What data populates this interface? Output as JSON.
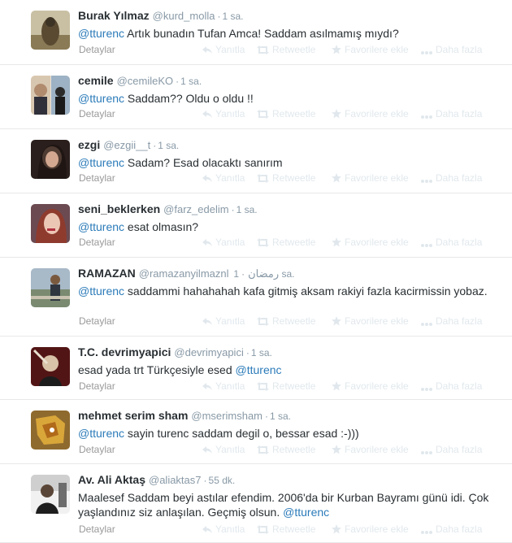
{
  "labels": {
    "details": "Detaylar",
    "reply": "Yanıtla",
    "retweet": "Retweetle",
    "favorite": "Favorilere ekle",
    "more": "Daha fazla"
  },
  "tweets": [
    {
      "name": "Burak Yılmaz",
      "handle": "@kurd_molla",
      "dot": "·",
      "time": "1 sa.",
      "segments": [
        {
          "t": "@tturenc",
          "m": true
        },
        {
          "t": " Artık bunadın Tufan Amca! Saddam asılmamış mıydı?",
          "m": false
        }
      ]
    },
    {
      "name": "cemile",
      "handle": "@cemileKO",
      "dot": "·",
      "time": "1 sa.",
      "segments": [
        {
          "t": "@tturenc",
          "m": true
        },
        {
          "t": " Saddam?? Oldu o oldu !!",
          "m": false
        }
      ]
    },
    {
      "name": "ezgi",
      "handle": "@ezgii__t",
      "dot": "·",
      "time": "1 sa.",
      "segments": [
        {
          "t": "@tturenc",
          "m": true
        },
        {
          "t": " Sadam? Esad olacaktı sanırım",
          "m": false
        }
      ]
    },
    {
      "name": "seni_beklerken",
      "handle": "@farz_edelim",
      "dot": "·",
      "time": "1 sa.",
      "segments": [
        {
          "t": "@tturenc",
          "m": true
        },
        {
          "t": " esat olmasın?",
          "m": false
        }
      ]
    },
    {
      "name": "RAMAZAN",
      "handle": "@ramazanyilmaznl",
      "handle_extra": "رمضان",
      "dot": "·",
      "time": "1 sa.",
      "segments": [
        {
          "t": "@tturenc",
          "m": true
        },
        {
          "t": " saddammi hahahahah kafa gitmiş aksam rakiyi fazla kacirmissin yobaz.",
          "m": false
        }
      ]
    },
    {
      "name": "T.C. devrimyapici",
      "handle": "@devrimyapici",
      "dot": "·",
      "time": "1 sa.",
      "segments": [
        {
          "t": "esad yada trt Türkçesiyle esed ",
          "m": false
        },
        {
          "t": "@tturenc",
          "m": true
        }
      ]
    },
    {
      "name": "mehmet serim sham",
      "handle": "@mserimsham",
      "dot": "·",
      "time": "1 sa.",
      "segments": [
        {
          "t": "@tturenc",
          "m": true
        },
        {
          "t": " sayin turenc saddam degil o, bessar esad :-)))",
          "m": false
        }
      ]
    },
    {
      "name": "Av. Ali Aktaş",
      "handle": "@aliaktas7",
      "dot": "·",
      "time": "55 dk.",
      "segments": [
        {
          "t": "Maalesef Saddam beyi astılar efendim. 2006'da bir Kurban Bayramı günü idi. Çok yaşlandınız siz anlaşılan. Geçmiş olsun. ",
          "m": false
        },
        {
          "t": "@tturenc",
          "m": true
        }
      ]
    }
  ],
  "colors": {
    "name": "#292f33",
    "meta": "#8899a6",
    "link": "#2b7bb9",
    "action_faded": "#e1e8ed",
    "details": "#999999",
    "divider": "#e8e8e8"
  }
}
